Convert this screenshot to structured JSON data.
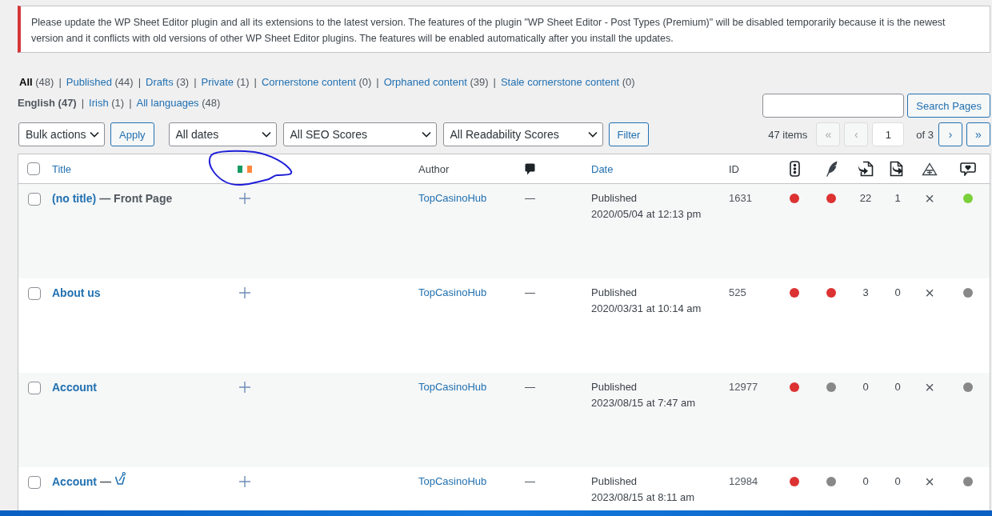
{
  "notice": {
    "kind": "error",
    "text": "Please update the WP Sheet Editor plugin and all its extensions to the latest version. The features of the plugin \"WP Sheet Editor - Post Types (Premium)\" will be disabled temporarily because it is the newest version and it conflicts with old versions of other WP Sheet Editor plugins. The features will be enabled automatically after you install the updates."
  },
  "views": [
    {
      "label": "All",
      "count": "(48)",
      "selected": true,
      "separator": "|"
    },
    {
      "label": "Published",
      "count": "(44)",
      "selected": false,
      "separator": "|"
    },
    {
      "label": "Drafts",
      "count": "(3)",
      "selected": false,
      "separator": "|"
    },
    {
      "label": "Private",
      "count": "(1)",
      "selected": false,
      "separator": "|"
    },
    {
      "label": "Cornerstone content",
      "count": "(0)",
      "selected": false,
      "separator": "|"
    },
    {
      "label": "Orphaned content",
      "count": "(39)",
      "selected": false,
      "separator": "|"
    },
    {
      "label": "Stale cornerstone content",
      "count": "(0)",
      "selected": false
    }
  ],
  "languages": [
    {
      "label": "English",
      "count": "(47)",
      "selected": true,
      "separator": "|"
    },
    {
      "label": "Irish",
      "count": "(1)",
      "selected": false,
      "separator": "|"
    },
    {
      "label": "All languages",
      "count": "(48)",
      "selected": false
    }
  ],
  "search": {
    "button": "Search Pages"
  },
  "toolbar": {
    "bulk_actions": "Bulk actions",
    "apply": "Apply",
    "filters": [
      "All dates",
      "All SEO Scores",
      "All Readability Scores"
    ],
    "filter_button": "Filter"
  },
  "pagination": {
    "count": "47 items",
    "before": [
      {
        "label": "«",
        "disabled": true
      },
      {
        "label": "‹",
        "disabled": true
      }
    ],
    "page": "1",
    "total": "of 3",
    "after": [
      {
        "label": "›",
        "disabled": false
      },
      {
        "label": "»",
        "disabled": false
      }
    ]
  },
  "table": {
    "header": {
      "checked": false,
      "title": "Title",
      "author": "Author",
      "date": "Date",
      "id": "ID"
    },
    "rows": [
      {
        "checked": false,
        "title": "(no title)",
        "post_state": "— Front Page",
        "has_icon": false,
        "author": "TopCasinoHub",
        "comments": "—",
        "status": "Published",
        "date": "2020/05/04 at 12:13 pm",
        "id": "1631",
        "column_8": {
          "color": "#dc3232"
        },
        "column_9": {
          "color": "#dc3232"
        },
        "column_10": "22",
        "column_11": "1",
        "column_12": "×",
        "column_13": {
          "color": "#7ad03a"
        }
      },
      {
        "checked": false,
        "title": "About us",
        "has_icon": false,
        "author": "TopCasinoHub",
        "comments": "—",
        "status": "Published",
        "date": "2020/03/31 at 10:14 am",
        "id": "525",
        "column_8": {
          "color": "#dc3232"
        },
        "column_9": {
          "color": "#dc3232"
        },
        "column_10": "3",
        "column_11": "0",
        "column_12": "×",
        "column_13": {
          "color": "#888888"
        }
      },
      {
        "checked": false,
        "title": "Account",
        "has_icon": false,
        "author": "TopCasinoHub",
        "comments": "—",
        "status": "Published",
        "date": "2023/08/15 at 7:47 am",
        "id": "12977",
        "column_8": {
          "color": "#dc3232"
        },
        "column_9": {
          "color": "#888888"
        },
        "column_10": "0",
        "column_11": "0",
        "column_12": "×",
        "column_13": {
          "color": "#888888"
        }
      },
      {
        "checked": false,
        "title": "Account",
        "post_state": "—",
        "has_icon": true,
        "author": "TopCasinoHub",
        "comments": "—",
        "status": "Published",
        "date": "2023/08/15 at 8:11 am",
        "id": "12984",
        "column_8": {
          "color": "#dc3232"
        },
        "column_9": {
          "color": "#888888"
        },
        "column_10": "0",
        "column_11": "0",
        "column_12": "×",
        "column_13": {
          "color": "#888888"
        }
      }
    ]
  }
}
